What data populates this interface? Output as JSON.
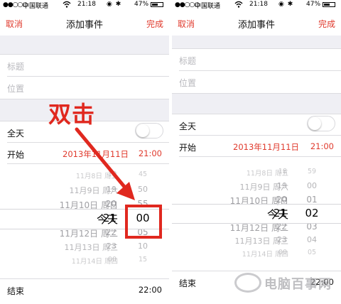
{
  "status_bar": {
    "signal": "●●○○○",
    "carrier": "中国联通",
    "wifi_icon": "wifi-icon",
    "time": "21:18",
    "icons": "◉ ✱",
    "battery": "47%"
  },
  "nav": {
    "cancel": "取消",
    "title": "添加事件",
    "done": "完成"
  },
  "form": {
    "title_placeholder": "标题",
    "location_placeholder": "位置",
    "allday_label": "全天",
    "allday_on": false,
    "start_label": "开始",
    "start_date": "2013年11月11日",
    "start_time": "21:00",
    "end_label": "结束",
    "end_time": "22:00",
    "end_time_right": "22:00"
  },
  "left_picker": {
    "dates": [
      "11月8日 周五",
      "11月9日 周六",
      "11月10日 周日",
      "今天",
      "11月12日 周二",
      "11月13日 周三",
      "11月14日 周四"
    ],
    "hours": [
      "18",
      "19",
      "20",
      "21",
      "22",
      "23",
      "00"
    ],
    "minutes": [
      "45",
      "50",
      "55",
      "00",
      "05",
      "10",
      "15"
    ]
  },
  "right_picker": {
    "dates": [
      "11月7日 周四",
      "11月8日 周五",
      "11月9日 周六",
      "11月10日 周日",
      "今天",
      "11月12日 周二",
      "11月13日 周三",
      "11月14日 周四"
    ],
    "hours": [
      "17",
      "18",
      "19",
      "20",
      "21",
      "22",
      "23",
      "00"
    ],
    "minutes": [
      "58",
      "59",
      "00",
      "01",
      "02",
      "03",
      "04",
      "05"
    ]
  },
  "annotation": {
    "text": "双击"
  },
  "watermark": {
    "text": "电脑百事网"
  }
}
